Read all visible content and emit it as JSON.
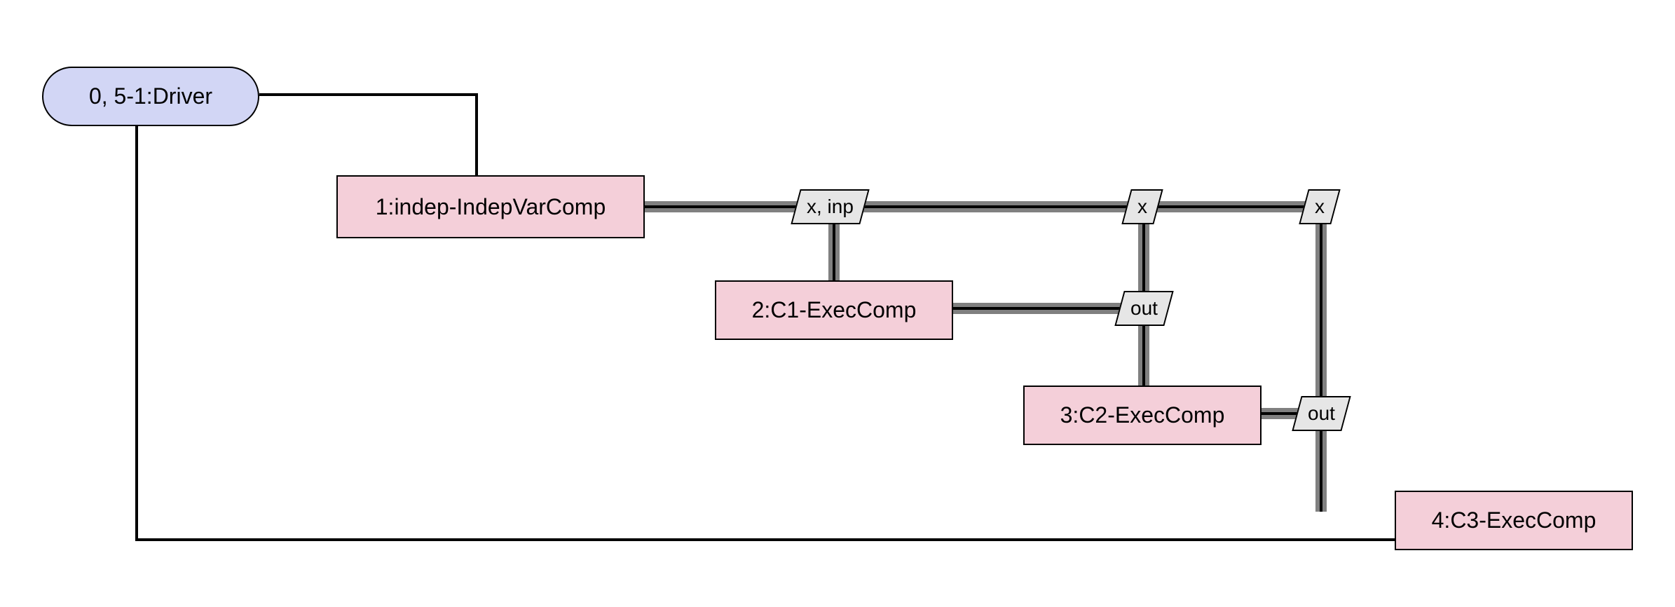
{
  "colors": {
    "driver_bg": "#d2d6f5",
    "comp_bg": "#f4cfd9",
    "conn_bg": "#e6e6e6",
    "thick_line": "#808080",
    "thin_line": "#000000"
  },
  "diagram": {
    "nodes": {
      "driver": {
        "label": "0, 5-1:Driver"
      },
      "indep": {
        "label": "1:indep-IndepVarComp"
      },
      "c1": {
        "label": "2:C1-ExecComp"
      },
      "c2": {
        "label": "3:C2-ExecComp"
      },
      "c3": {
        "label": "4:C3-ExecComp"
      }
    },
    "connectors": {
      "c_xinp": {
        "label": "x, inp"
      },
      "c_x1": {
        "label": "x"
      },
      "c_x2": {
        "label": "x"
      },
      "c_out1": {
        "label": "out"
      },
      "c_out2": {
        "label": "out"
      }
    }
  }
}
